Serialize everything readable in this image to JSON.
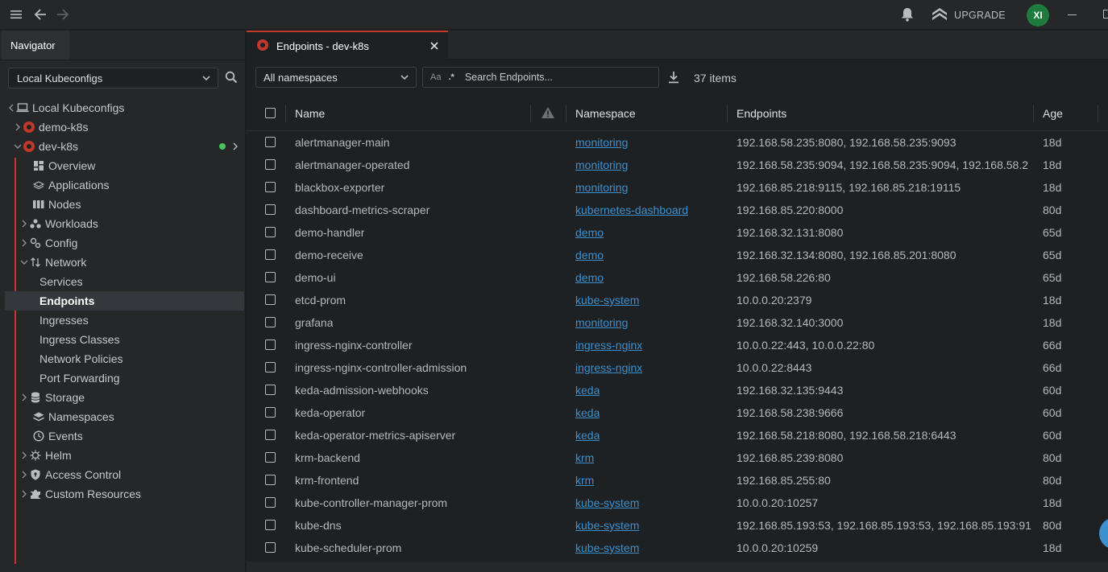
{
  "topbar": {
    "upgrade_label": "UPGRADE",
    "avatar_initials": "XI"
  },
  "sidebar": {
    "tab_label": "Navigator",
    "kubeconfig_select": "Local Kubeconfigs",
    "tree": {
      "root": "Local Kubeconfigs",
      "clusters": [
        "demo-k8s",
        "dev-k8s"
      ],
      "items": {
        "overview": "Overview",
        "applications": "Applications",
        "nodes": "Nodes",
        "workloads": "Workloads",
        "config": "Config",
        "network": "Network",
        "services": "Services",
        "endpoints": "Endpoints",
        "ingresses": "Ingresses",
        "ingress_classes": "Ingress Classes",
        "network_policies": "Network Policies",
        "port_forwarding": "Port Forwarding",
        "storage": "Storage",
        "namespaces": "Namespaces",
        "events": "Events",
        "helm": "Helm",
        "access_control": "Access Control",
        "custom_resources": "Custom Resources"
      }
    }
  },
  "main": {
    "tab_title": "Endpoints - dev-k8s",
    "namespace_select": "All namespaces",
    "search": {
      "case_label": "Aa",
      "regex_label": ".*",
      "placeholder": "Search Endpoints..."
    },
    "items_count": "37 items",
    "columns": {
      "name": "Name",
      "namespace": "Namespace",
      "endpoints": "Endpoints",
      "age": "Age"
    },
    "rows": [
      {
        "name": "alertmanager-main",
        "namespace": "monitoring",
        "endpoints": "192.168.58.235:8080, 192.168.58.235:9093",
        "age": "18d"
      },
      {
        "name": "alertmanager-operated",
        "namespace": "monitoring",
        "endpoints": "192.168.58.235:9094, 192.168.58.235:9094, 192.168.58.2",
        "age": "18d"
      },
      {
        "name": "blackbox-exporter",
        "namespace": "monitoring",
        "endpoints": "192.168.85.218:9115, 192.168.85.218:19115",
        "age": "18d"
      },
      {
        "name": "dashboard-metrics-scraper",
        "namespace": "kubernetes-dashboard",
        "endpoints": "192.168.85.220:8000",
        "age": "80d"
      },
      {
        "name": "demo-handler",
        "namespace": "demo",
        "endpoints": "192.168.32.131:8080",
        "age": "65d"
      },
      {
        "name": "demo-receive",
        "namespace": "demo",
        "endpoints": "192.168.32.134:8080, 192.168.85.201:8080",
        "age": "65d"
      },
      {
        "name": "demo-ui",
        "namespace": "demo",
        "endpoints": "192.168.58.226:80",
        "age": "65d"
      },
      {
        "name": "etcd-prom",
        "namespace": "kube-system",
        "endpoints": "10.0.0.20:2379",
        "age": "18d"
      },
      {
        "name": "grafana",
        "namespace": "monitoring",
        "endpoints": "192.168.32.140:3000",
        "age": "18d"
      },
      {
        "name": "ingress-nginx-controller",
        "namespace": "ingress-nginx",
        "endpoints": "10.0.0.22:443, 10.0.0.22:80",
        "age": "66d"
      },
      {
        "name": "ingress-nginx-controller-admission",
        "namespace": "ingress-nginx",
        "endpoints": "10.0.0.22:8443",
        "age": "66d"
      },
      {
        "name": "keda-admission-webhooks",
        "namespace": "keda",
        "endpoints": "192.168.32.135:9443",
        "age": "60d"
      },
      {
        "name": "keda-operator",
        "namespace": "keda",
        "endpoints": "192.168.58.238:9666",
        "age": "60d"
      },
      {
        "name": "keda-operator-metrics-apiserver",
        "namespace": "keda",
        "endpoints": "192.168.58.218:8080, 192.168.58.218:6443",
        "age": "60d"
      },
      {
        "name": "krm-backend",
        "namespace": "krm",
        "endpoints": "192.168.85.239:8080",
        "age": "80d"
      },
      {
        "name": "krm-frontend",
        "namespace": "krm",
        "endpoints": "192.168.85.255:80",
        "age": "80d"
      },
      {
        "name": "kube-controller-manager-prom",
        "namespace": "kube-system",
        "endpoints": "10.0.0.20:10257",
        "age": "18d"
      },
      {
        "name": "kube-dns",
        "namespace": "kube-system",
        "endpoints": "192.168.85.193:53, 192.168.85.193:53, 192.168.85.193:91",
        "age": "80d"
      },
      {
        "name": "kube-scheduler-prom",
        "namespace": "kube-system",
        "endpoints": "10.0.0.20:10259",
        "age": "18d"
      }
    ]
  },
  "colors": {
    "accent_red": "#c0392b",
    "link_blue": "#3d90ce",
    "status_green": "#48c45e",
    "avatar_green": "#1f7a3d"
  },
  "icons": [
    "menu-icon",
    "back-arrow-icon",
    "forward-arrow-icon",
    "bell-icon",
    "upgrade-icon",
    "search-icon",
    "laptop-icon",
    "cluster-icon",
    "download-icon",
    "warning-icon",
    "close-icon"
  ]
}
